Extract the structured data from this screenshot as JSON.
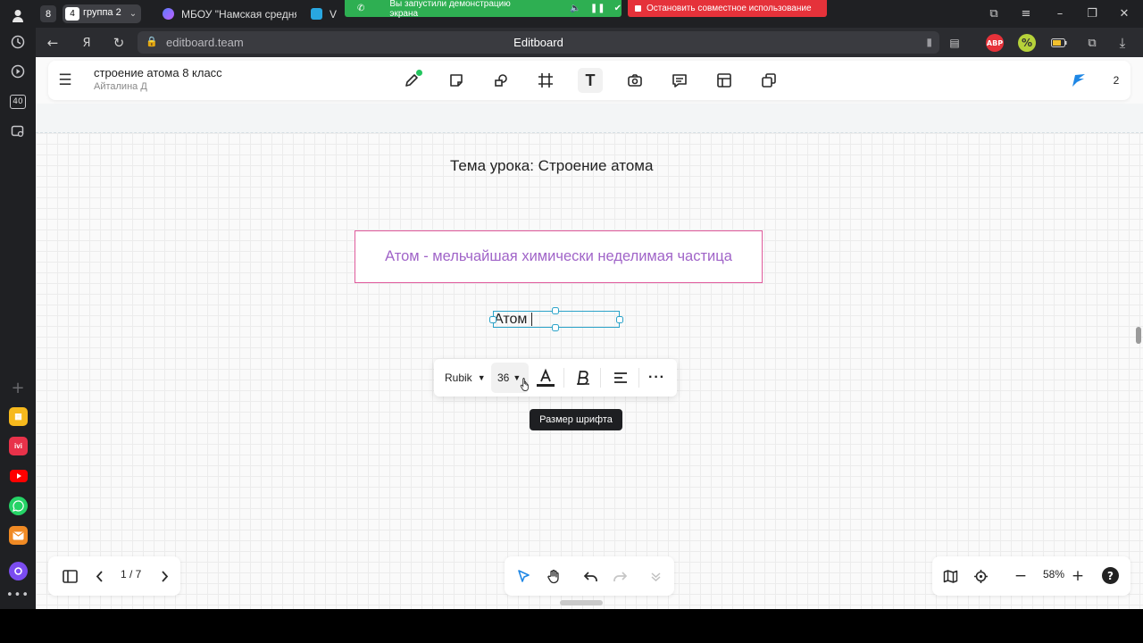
{
  "browser": {
    "tabs": {
      "workspace_count": "8",
      "group_count": "4",
      "group_label": "группа 2",
      "tab1_title": "МБОУ \"Намская средняя",
      "tab2_title": "V"
    },
    "screen_share": {
      "green_text": "Вы запустили демонстрацию экрана",
      "red_text": "Остановить совместное использование"
    },
    "address_bar": {
      "url": "editboard.team",
      "page_title": "Editboard"
    },
    "rail_badge": "40",
    "extensions": {
      "abp": "ABP"
    }
  },
  "board": {
    "name": "строение атома 8 класс",
    "owner": "Айталина Д",
    "users_count": "2",
    "lesson_title": "Тема урока: Строение атома",
    "definition": "Атом - мельчайшая химически неделимая частица",
    "selected_text": "Атом",
    "format_bar": {
      "font_name": "Rubik",
      "font_size": "36",
      "tooltip": "Размер шрифта"
    },
    "pagination": {
      "indicator": "1 / 7"
    },
    "zoom": {
      "value": "58%"
    },
    "help": "?"
  },
  "colors": {
    "accent_blue": "#1f87e5",
    "definition_border": "#e05a9c",
    "definition_text": "#a064c8",
    "selection": "#2ba3c9",
    "share_green": "#2eaf52",
    "share_red": "#e5323a"
  }
}
